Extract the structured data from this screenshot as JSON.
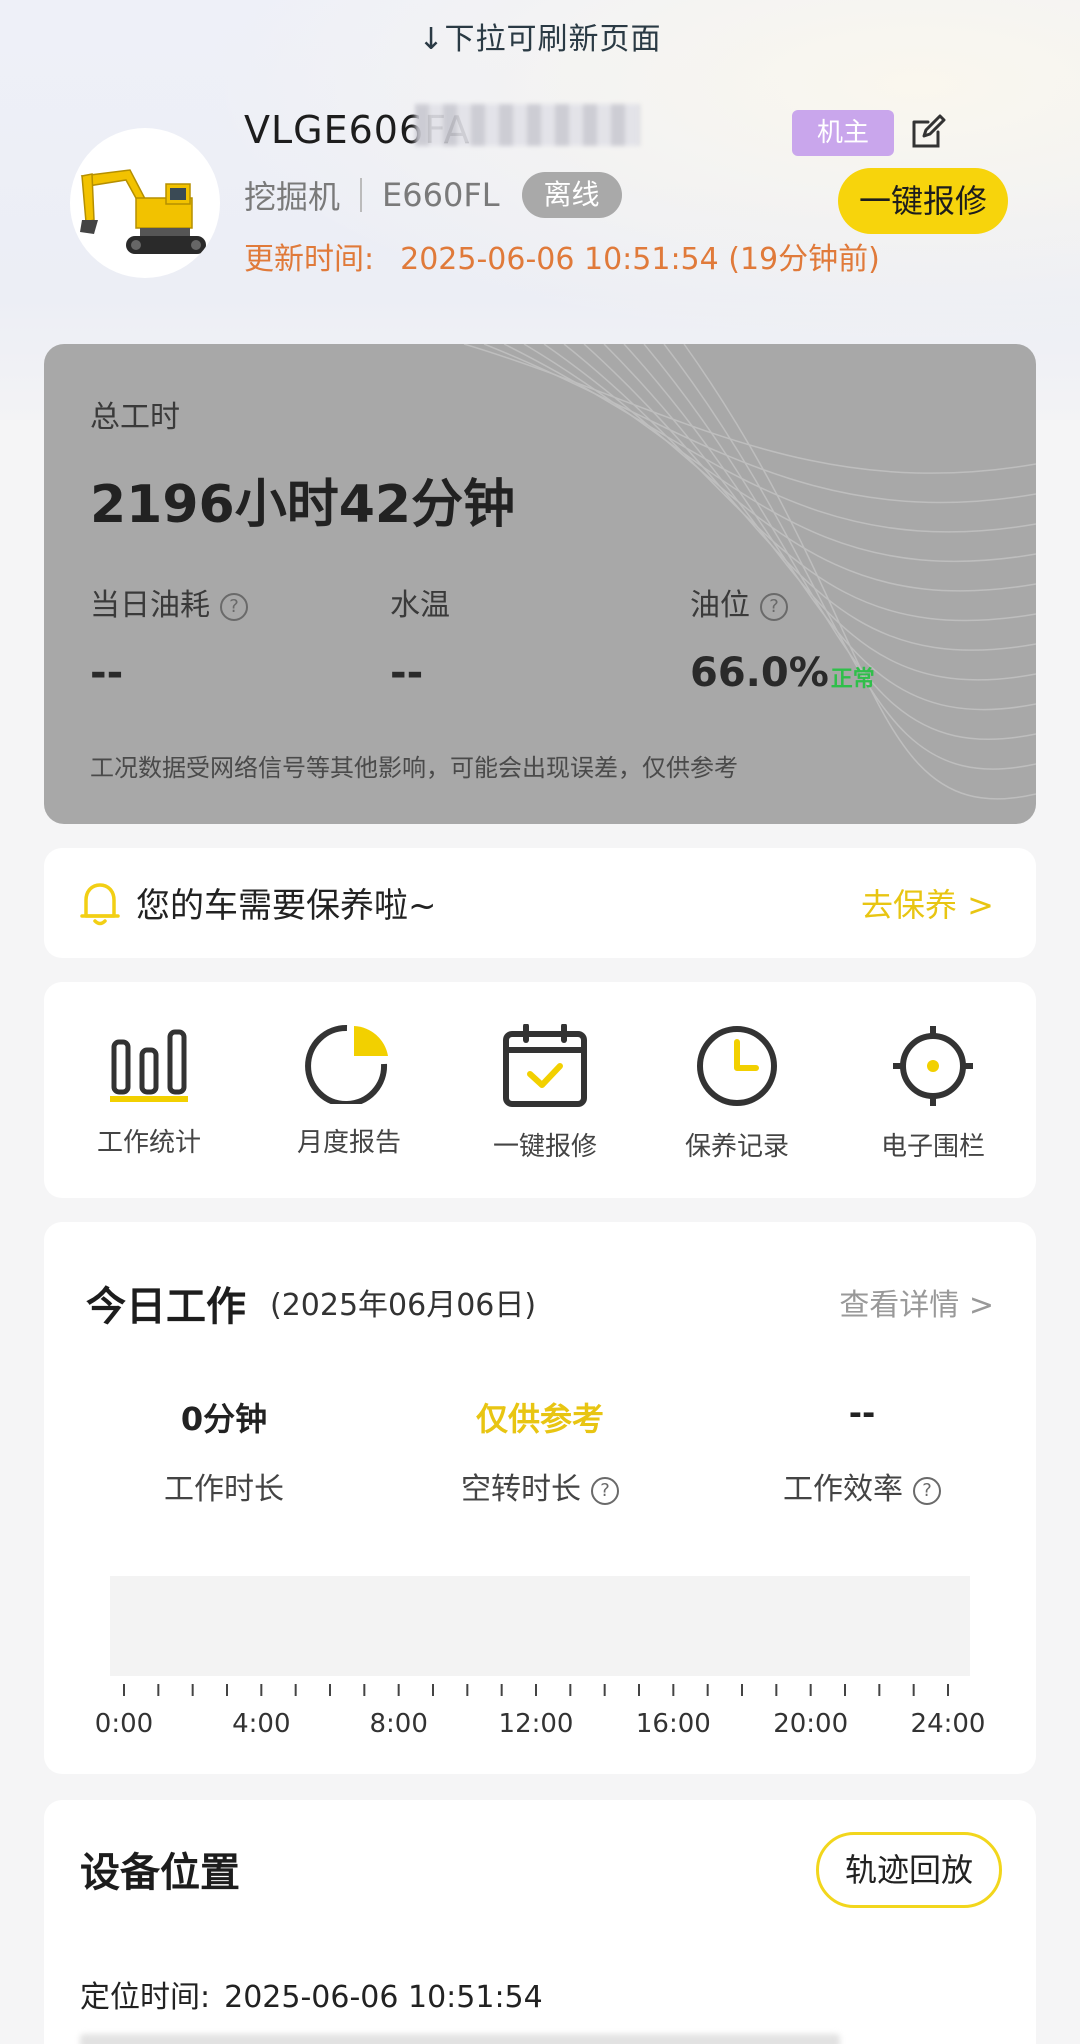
{
  "pull_hint": "↓下拉可刷新页面",
  "device": {
    "vin": "VLGE606FA",
    "owner_badge": "机主",
    "type": "挖掘机",
    "model": "E660FL",
    "status": "离线",
    "repair_button": "一键报修",
    "update_label": "更新时间:",
    "update_value": "2025-06-06 10:51:54 (19分钟前)"
  },
  "stats": {
    "total_label": "总工时",
    "total_value": "2196小时42分钟",
    "fuel_label": "当日油耗",
    "fuel_value": "--",
    "water_label": "水温",
    "water_value": "--",
    "oil_label": "油位",
    "oil_value": "66.0%",
    "oil_status": "正常",
    "disclaimer": "工况数据受网络信号等其他影响，可能会出现误差，仅供参考"
  },
  "maintenance": {
    "message": "您的车需要保养啦~",
    "link": "去保养 >"
  },
  "shortcuts": [
    {
      "label": "工作统计",
      "icon": "bar-chart-icon"
    },
    {
      "label": "月度报告",
      "icon": "pie-chart-icon"
    },
    {
      "label": "一键报修",
      "icon": "calendar-check-icon"
    },
    {
      "label": "保养记录",
      "icon": "clock-icon"
    },
    {
      "label": "电子围栏",
      "icon": "crosshair-icon"
    }
  ],
  "today": {
    "title": "今日工作",
    "date": "(2025年06月06日)",
    "link": "查看详情 >",
    "work_duration_value": "0分钟",
    "work_duration_label": "工作时长",
    "idle_value": "仅供参考",
    "idle_label": "空转时长",
    "efficiency_value": "--",
    "efficiency_label": "工作效率",
    "axis_labels": [
      "0:00",
      "4:00",
      "8:00",
      "12:00",
      "16:00",
      "20:00",
      "24:00"
    ]
  },
  "location": {
    "title": "设备位置",
    "replay_button": "轨迹回放",
    "time_label": "定位时间:",
    "time_value": "2025-06-06 10:51:54"
  },
  "colors": {
    "accent_yellow": "#f7d40c",
    "update_orange": "#e07a3a",
    "owner_purple": "#c9a6ec",
    "status_green": "#2fbf4a"
  }
}
